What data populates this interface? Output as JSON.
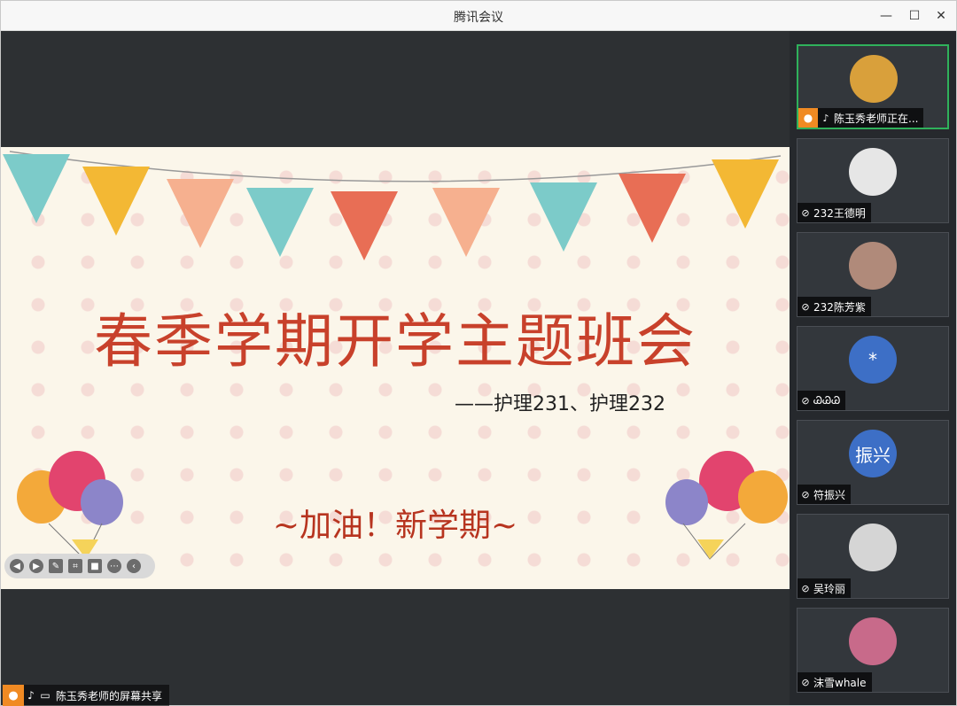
{
  "window": {
    "title": "腾讯会议",
    "minimize": "—",
    "maximize": "☐",
    "close": "✕"
  },
  "slide": {
    "title": "春季学期开学主题班会",
    "subtitle": "——护理231、护理232",
    "slogan": "~加油！新学期~",
    "bunting_colors": [
      "#7ccbc9",
      "#f3b834",
      "#f6b08f",
      "#7ccbc9",
      "#e86e55",
      "#f6b08f",
      "#7ccbc9",
      "#e86e55",
      "#f3b834"
    ]
  },
  "share": {
    "label": "陈玉秀老师的屏幕共享"
  },
  "participants": [
    {
      "name": "陈玉秀老师正在...",
      "avatar_text": "",
      "avatar_color": "#d9a03b",
      "active": true
    },
    {
      "name": "232王德明",
      "avatar_text": "",
      "avatar_color": "#e6e6e6",
      "active": false
    },
    {
      "name": "232陈芳紫",
      "avatar_text": "",
      "avatar_color": "#b08a7a",
      "active": false
    },
    {
      "name": "ᏊᏊᏊ",
      "avatar_text": "*",
      "avatar_color": "#3d6fc6",
      "active": false
    },
    {
      "name": "符振兴",
      "avatar_text": "振兴",
      "avatar_color": "#3d6fc6",
      "active": false
    },
    {
      "name": "吴玲丽",
      "avatar_text": "",
      "avatar_color": "#d5d5d5",
      "active": false
    },
    {
      "name": "沫雪whale",
      "avatar_text": "",
      "avatar_color": "#c86a8a",
      "active": false
    }
  ]
}
